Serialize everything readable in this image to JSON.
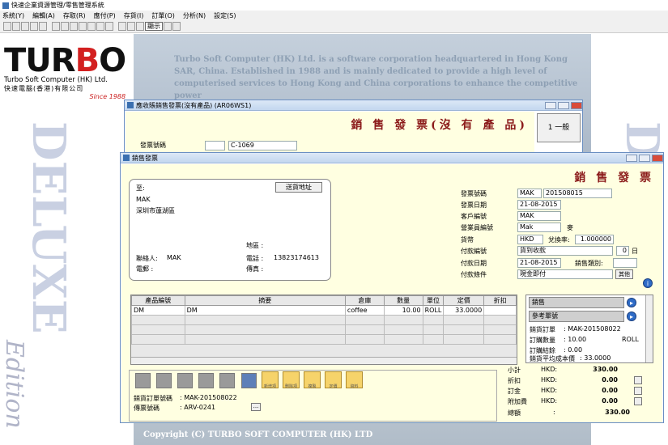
{
  "app": {
    "title": "快速企業資源管理/零售管理系統",
    "menu": [
      "系統(Y)",
      "編輯(A)",
      "存取(R)",
      "應付(P)",
      "存貨(I)",
      "訂單(O)",
      "分析(N)",
      "設定(S)"
    ],
    "toolbar_text": "顯示"
  },
  "brand": {
    "logo_pre": "TUR",
    "logo_accent": "B",
    "logo_post": "O",
    "company_en": "Turbo Soft Computer (HK) Ltd.",
    "company_cn": "快速電腦(香港)有限公司",
    "since": "Since 1988",
    "deluxe": "DELUXE",
    "edition": "Edition",
    "bg_text": "Turbo Soft Computer (HK) Ltd. is a software corporation headquartered in Hong Kong SAR, China. Established in 1988 and is mainly dedicated to provide a high level of computerised services to Hong Kong and China corporations to enhance the competitive power",
    "copyright": "Copyright (C) TURBO SOFT COMPUTER (HK) LTD"
  },
  "back_window": {
    "title": "應收賬銷售發票(沒有產品) (AR06WS1)",
    "heading": "銷 售 發 票(沒 有 產 品)",
    "side_button": "1 一般",
    "invoice_label": "發票號碼",
    "invoice_value": "C-1069"
  },
  "front_window": {
    "title": "銷售發票",
    "heading": "銷 售 發 票",
    "to_label": "至:",
    "delivery_button": "送貨地址",
    "customer_name": "MAK",
    "customer_address": "深圳市蓮湖區",
    "area_label": "地區 :",
    "contact_label": "聯絡人:",
    "contact_value": "MAK",
    "phone_label": "電話 :",
    "phone_value": "13823174613",
    "email_label": "電郵 :",
    "fax_label": "傳真 :",
    "fields": {
      "invoice_no_label": "發票號碼",
      "invoice_prefix": "MAK",
      "invoice_no": "201508015",
      "invoice_date_label": "發票日期",
      "invoice_date": "21-08-2015",
      "customer_code_label": "客戶編號",
      "customer_code": "MAK",
      "sales_code_label": "營業員編號",
      "sales_code": "Mak",
      "sales_name": "麥",
      "currency_label": "貨幣",
      "currency": "HKD",
      "rate_label": "兌換率:",
      "rate": "1.000000",
      "pay_code_label": "付款編號",
      "pay_code": "貨到收款",
      "pay_days": "0",
      "days_unit": "日",
      "pay_date_label": "付款日期",
      "pay_date": "21-08-2015",
      "sales_cat_label": "銷售類別:",
      "pay_terms_label": "付款條件",
      "pay_terms": "現金即付",
      "other_button": "其他"
    },
    "grid": {
      "headers": [
        "產品編號",
        "摘要",
        "倉庫",
        "數量",
        "單位",
        "定價",
        "折扣"
      ],
      "rows": [
        [
          "DM",
          "DM",
          "coffee",
          "10.00",
          "ROLL",
          "33.0000",
          ""
        ]
      ]
    },
    "side_panel": {
      "tab1": "銷售",
      "tab2": "參考單號",
      "order_label": "銷貨訂單",
      "order_value": ": MAK-201508022",
      "qty_label": "訂購數量",
      "qty_value": ": 10.00",
      "qty_unit": "ROLL",
      "balance_label": "訂購結餘",
      "balance_value": ": 0.00",
      "avgcost_label": "銷貨平均成本價",
      "avgcost_value": ": 33.0000"
    },
    "function_buttons": [
      "新增項",
      "刪除項",
      "複製",
      "定價",
      "資料"
    ],
    "order_no_label": "銷貨訂單號碼",
    "order_no_value": ": MAK-201508022",
    "delivery_no_label": "傳票號碼",
    "delivery_no_value": ": ARV-0241",
    "totals": [
      {
        "label": "小計",
        "cur": "HKD:",
        "value": "330.00"
      },
      {
        "label": "折扣",
        "cur": "HKD:",
        "value": "0.00"
      },
      {
        "label": "訂金",
        "cur": "HKD:",
        "value": "0.00"
      },
      {
        "label": "附加費",
        "cur": "HKD:",
        "value": "0.00"
      }
    ],
    "grand_label": "總額",
    "grand_sep": ":",
    "grand_value": "330.00"
  }
}
